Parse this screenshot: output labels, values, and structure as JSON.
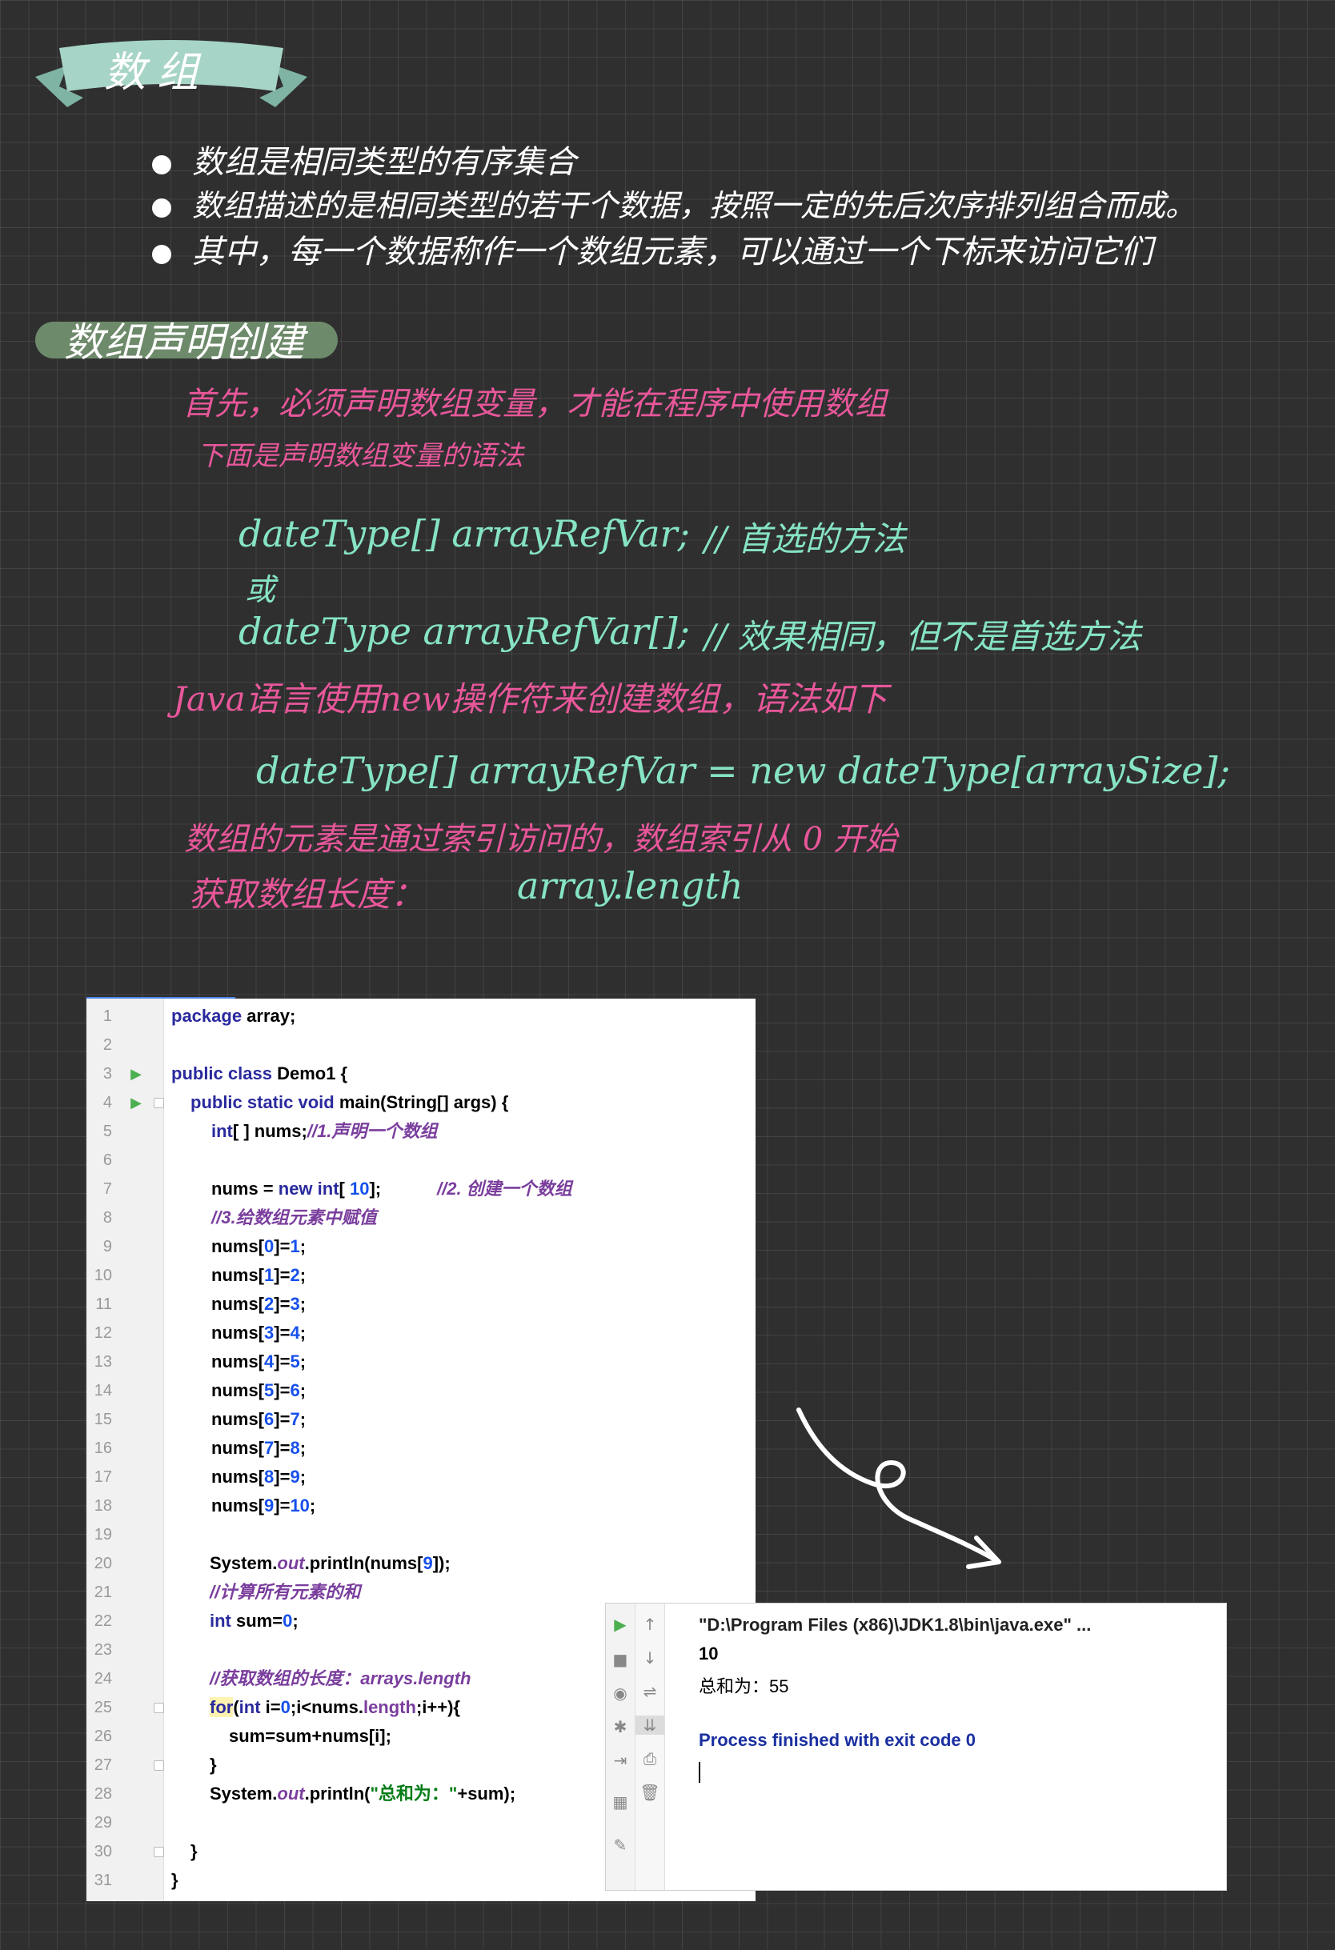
{
  "title": "数组",
  "bullets": [
    "数组是相同类型的有序集合",
    "数组描述的是相同类型的若干个数据，按照一定的先后次序排列组合而成。",
    "其中，每一个数据称作一个数组元素，可以通过一个下标来访问它们"
  ],
  "section_title": "数组声明创建",
  "notes": {
    "line1": "首先，必须声明数组变量，才能在程序中使用数组",
    "line2": "下面是声明数组变量的语法",
    "syntax1": "dateType[] arrayRefVar;",
    "syntax1_comment": "// 首选的方法",
    "or": "或",
    "syntax2": "dateType  arrayRefVar[];",
    "syntax2_comment": "// 效果相同，但不是首选方法",
    "line3": "Java语言使用new操作符来创建数组，语法如下",
    "syntax3": "dateType[] arrayRefVar =  new   dateType[arraySize];",
    "line4": "数组的元素是通过索引访问的，数组索引从 0 开始",
    "line5_label": "获取数组长度：",
    "line5_code": "array.length"
  },
  "code": {
    "l1_kw": "package",
    "l1_rest": " array;",
    "l3_kw": "public class",
    "l3_rest": " Demo1 {",
    "l4_kw": "public static void",
    "l4_rest": " main(String[] args) {",
    "l5_kw": "int",
    "l5_rest": "[ ] nums;",
    "l5_cm": "//1.声明一个数组",
    "l7_a": "nums = ",
    "l7_kw": "new int",
    "l7_b": "[ ",
    "l7_num": "10",
    "l7_c": "];",
    "l7_cm": "//2. 创建一个数组",
    "l8_cm": "//3.给数组元素中赋值",
    "assign_prefix": "nums[",
    "assigns": [
      {
        "i": "0",
        "v": "1"
      },
      {
        "i": "1",
        "v": "2"
      },
      {
        "i": "2",
        "v": "3"
      },
      {
        "i": "3",
        "v": "4"
      },
      {
        "i": "4",
        "v": "5"
      },
      {
        "i": "5",
        "v": "6"
      },
      {
        "i": "6",
        "v": "7"
      },
      {
        "i": "7",
        "v": "8"
      },
      {
        "i": "8",
        "v": "9"
      },
      {
        "i": "9",
        "v": "10"
      }
    ],
    "l20_a": "System.",
    "l20_out": "out",
    "l20_b": ".println(nums[",
    "l20_idx": "9",
    "l20_c": "]);",
    "l21_cm": "//计算所有元素的和",
    "l22_kw": "int",
    "l22_rest": " sum=",
    "l22_num": "0",
    "l22_end": ";",
    "l24_cm": "//获取数组的长度：arrays.length",
    "l25_kw": "for",
    "l25_a": "(",
    "l25_kw2": "int",
    "l25_b": " i=",
    "l25_n0": "0",
    "l25_c": ";i<nums.",
    "l25_len": "length",
    "l25_d": ";i++){",
    "l26": "sum=sum+nums[i];",
    "l27": "}",
    "l28_a": "System.",
    "l28_out": "out",
    "l28_b": ".println(",
    "l28_str": "\"总和为：\"",
    "l28_c": "+sum);",
    "l30": "}",
    "l31": "}"
  },
  "console": {
    "path": "\"D:\\Program Files (x86)\\JDK1.8\\bin\\java.exe\" ...",
    "out1": "10",
    "out2": "总和为：55",
    "exit": "Process finished with exit code 0"
  },
  "colors": {
    "background": "#2f2f30",
    "pink": "#e8579a",
    "mint": "#86e4c4",
    "banner": "#a6d4c6",
    "pill": "#6d8a6a"
  }
}
